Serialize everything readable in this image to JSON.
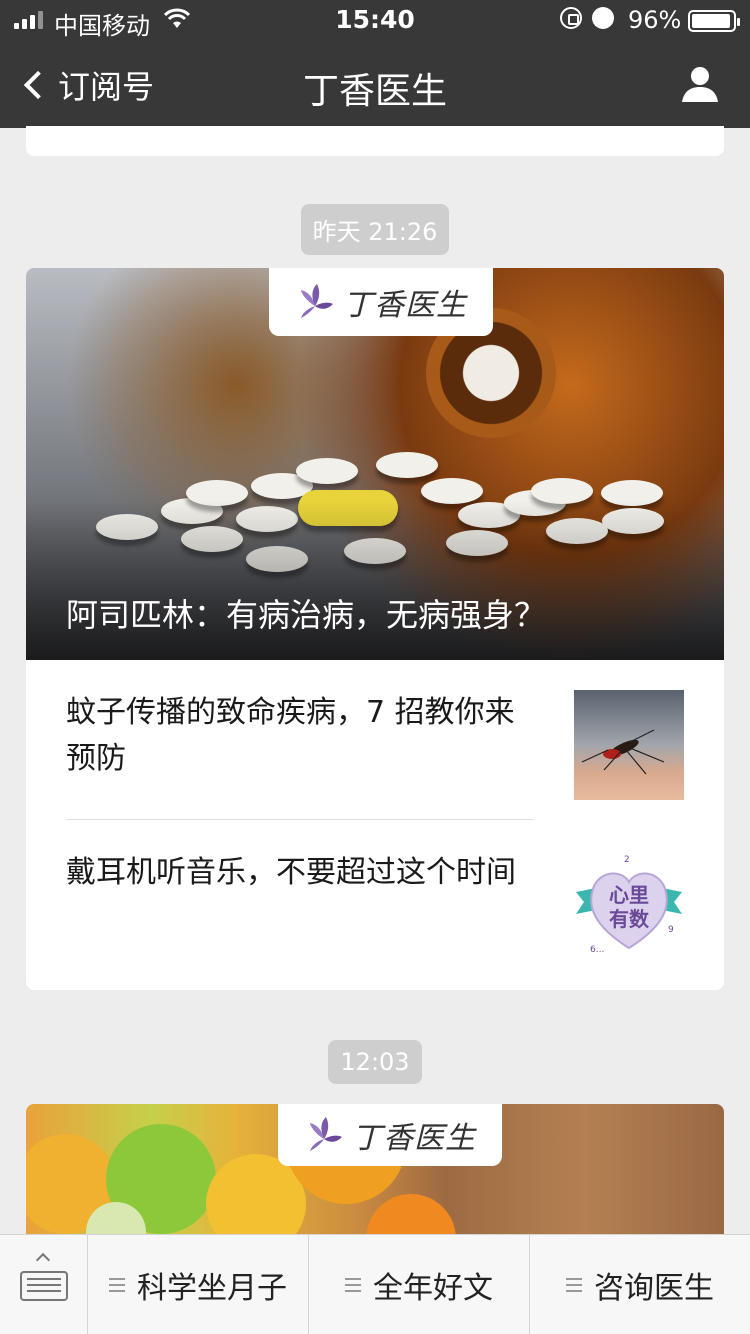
{
  "status_bar": {
    "carrier": "中国移动",
    "time": "15:40",
    "battery_pct": "96%",
    "battery_level": 0.96
  },
  "nav": {
    "back_label": "订阅号",
    "title": "丁香医生"
  },
  "timestamps": [
    "昨天 21:26",
    "12:03"
  ],
  "brand_tag": "丁香医生",
  "article_group": {
    "hero_title": "阿司匹林：有病治病，无病强身？",
    "items": [
      {
        "title": "蚊子传播的致命疾病，7 招教你来预防",
        "thumb": "mosquito-image"
      },
      {
        "title": "戴耳机听音乐，不要超过这个时间",
        "thumb": "heart-badge-image",
        "badge_text": "心里有数"
      }
    ]
  },
  "menu": {
    "keyboard_icon": "keyboard-icon",
    "items": [
      "科学坐月子",
      "全年好文",
      "咨询医生"
    ]
  },
  "colors": {
    "nav_bg": "#383838",
    "page_bg": "#ededed",
    "brand_purple": "#7a5aa8",
    "timestamp_bg": "#cecece"
  }
}
